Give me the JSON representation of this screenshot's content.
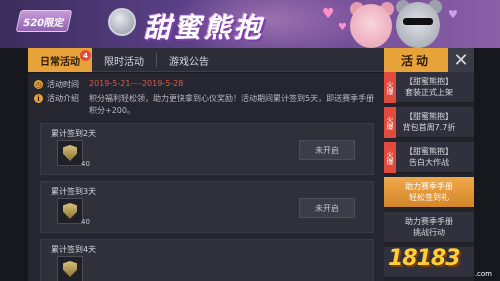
{
  "banner": {
    "tag": "520限定",
    "title": "甜蜜熊抱"
  },
  "tabs": [
    {
      "label": "日常活动",
      "badge": "4",
      "active": true
    },
    {
      "label": "限时活动",
      "active": false
    },
    {
      "label": "游戏公告",
      "active": false
    }
  ],
  "header": {
    "activity_label": "活动",
    "close_icon": "close-icon"
  },
  "info": {
    "time_label": "活动时间",
    "time_value": "2019-5-21----2019-5-28",
    "desc_label": "活动介绍",
    "desc_value": "积分福利轻松领，助力更快拿到心仪奖励！活动期间累计签到5天，即送赛季手册积分+200。"
  },
  "tasks": [
    {
      "title": "累计签到2天",
      "count": "40",
      "button": "未开启"
    },
    {
      "title": "累计签到3天",
      "count": "40",
      "button": "未开启"
    },
    {
      "title": "累计签到4天",
      "count": "",
      "button": ""
    }
  ],
  "sidebar": {
    "items": [
      {
        "label": "【甜蜜熊抱】\n套装正式上架",
        "hot": "火爆",
        "active": false
      },
      {
        "label": "【甜蜜熊抱】\n背包首周7.7折",
        "hot": "火爆",
        "active": false
      },
      {
        "label": "【甜蜜熊抱】\n告白大作战",
        "hot": "火爆",
        "active": false
      },
      {
        "label": "助力赛季手册\n轻松签到礼",
        "hot": "",
        "active": true
      },
      {
        "label": "助力赛季手册\n挑战行动",
        "hot": "",
        "active": false
      },
      {
        "label": "",
        "hot": "",
        "active": false
      }
    ]
  },
  "watermark": {
    "text": "18183",
    "sub": ".com"
  },
  "colors": {
    "accent": "#e8a23a",
    "date_red": "#e05a4c",
    "hot_red": "#e24b3b"
  }
}
